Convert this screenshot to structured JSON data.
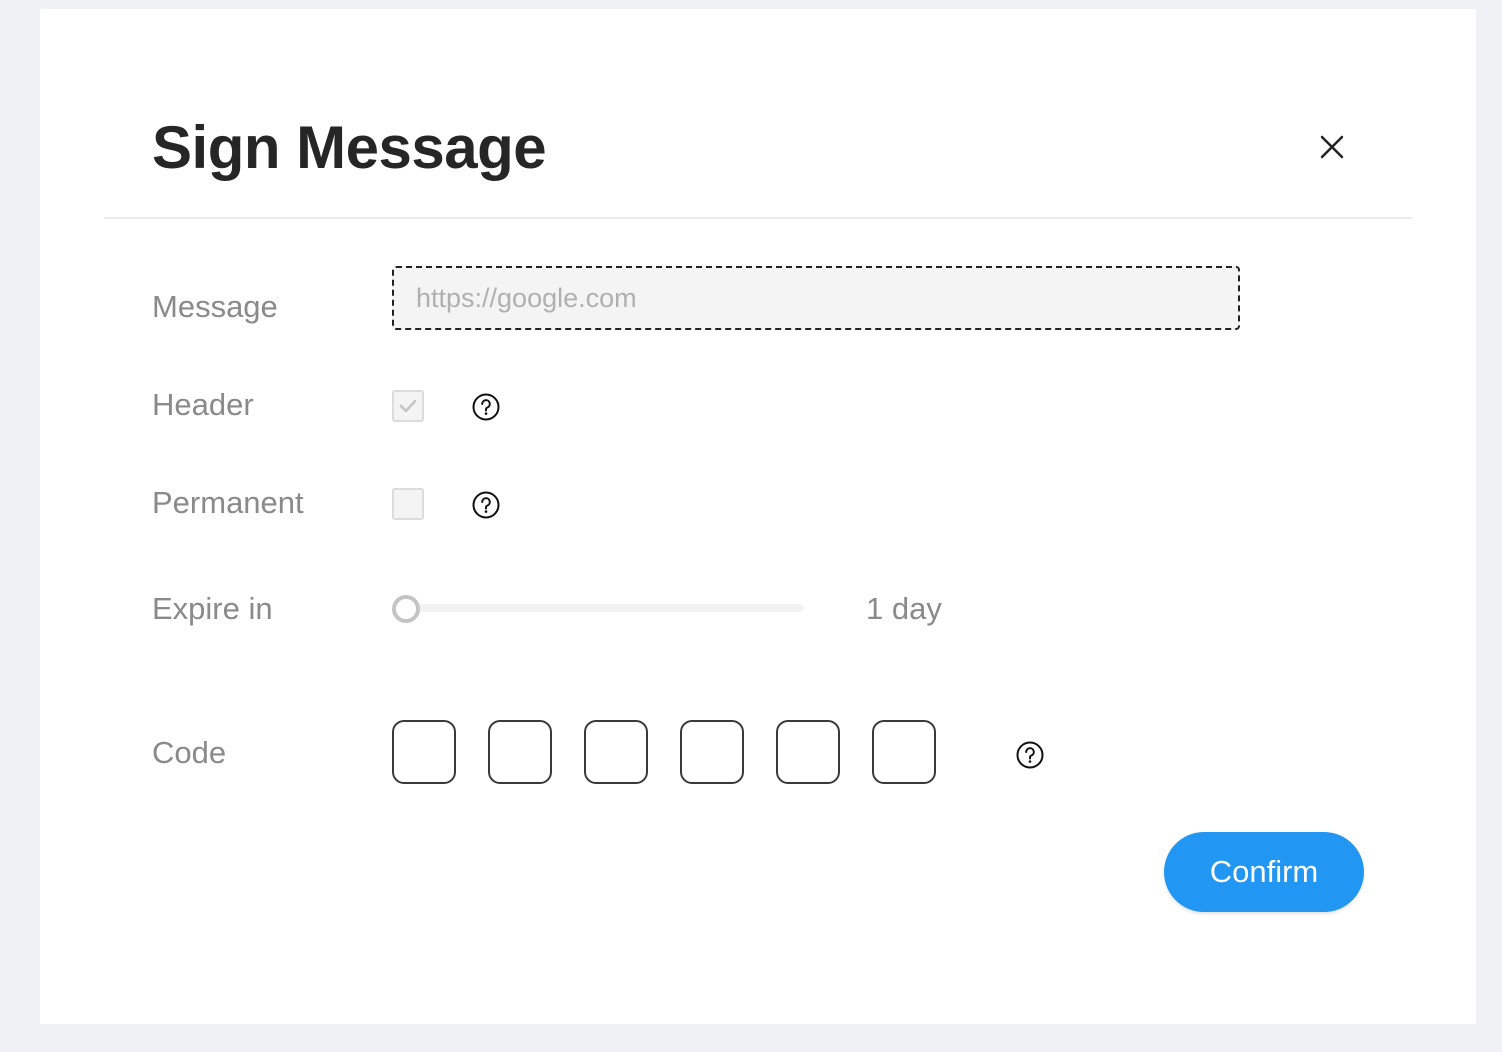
{
  "dialog": {
    "title": "Sign Message",
    "close_icon": "close-icon"
  },
  "fields": {
    "message": {
      "label": "Message",
      "value": "",
      "placeholder": "https://google.com"
    },
    "header": {
      "label": "Header",
      "checked": true,
      "disabled": true,
      "help_icon": "question-circle-icon"
    },
    "permanent": {
      "label": "Permanent",
      "checked": false,
      "help_icon": "question-circle-icon"
    },
    "expire": {
      "label": "Expire in",
      "value_text": "1 day",
      "slider_fraction": 0
    },
    "code": {
      "label": "Code",
      "digits": [
        "",
        "",
        "",
        "",
        "",
        ""
      ],
      "help_icon": "question-circle-icon"
    }
  },
  "actions": {
    "confirm_label": "Confirm"
  },
  "colors": {
    "accent": "#2196f3",
    "title": "#262626",
    "label": "#8a8a8a"
  }
}
